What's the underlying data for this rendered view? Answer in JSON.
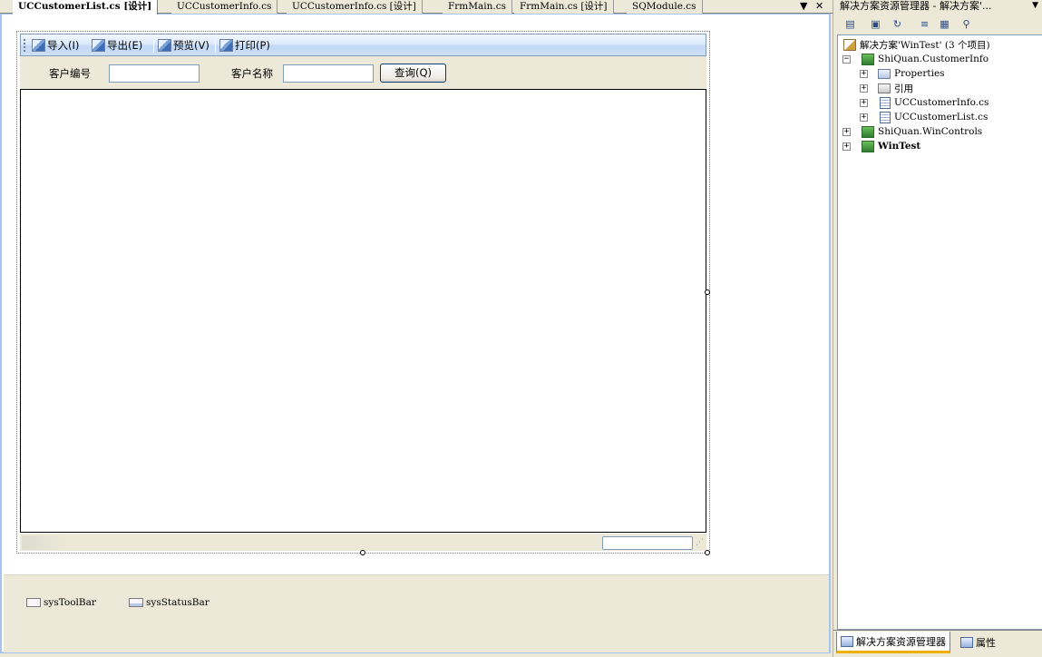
{
  "document_tabs": [
    {
      "label": "UCCustomerList.cs [设计]",
      "active": true
    },
    {
      "label": "UCCustomerInfo.cs",
      "active": false
    },
    {
      "label": "UCCustomerInfo.cs [设计]",
      "active": false
    },
    {
      "label": "FrmMain.cs",
      "active": false
    },
    {
      "label": "FrmMain.cs [设计]",
      "active": false
    },
    {
      "label": "SQModule.cs",
      "active": false
    }
  ],
  "tab_controls": {
    "dropdown": "▼",
    "close": "✕"
  },
  "toolbar": {
    "buttons": [
      {
        "label": "导入(I)",
        "icon": "image-icon"
      },
      {
        "label": "导出(E)",
        "icon": "image-icon"
      },
      {
        "label": "预览(V)",
        "icon": "image-icon"
      },
      {
        "label": "打印(P)",
        "icon": "image-icon"
      }
    ]
  },
  "query": {
    "customer_id_label": "客户编号",
    "customer_id_value": "",
    "customer_name_label": "客户名称",
    "customer_name_value": "",
    "search_button": "查询(Q)"
  },
  "component_tray": [
    {
      "label": "sysToolBar",
      "icon": "toolbar-component-icon"
    },
    {
      "label": "sysStatusBar",
      "icon": "statusbar-component-icon"
    }
  ],
  "solution_explorer": {
    "title": "解决方案资源管理器 - 解决方案'...",
    "pin": "▼",
    "toolbar_icons": [
      "properties-icon",
      "show-all-files-icon",
      "refresh-icon",
      "view-code-icon",
      "view-designer-icon",
      "class-diagram-icon"
    ],
    "tree": [
      {
        "label": "解决方案'WinTest' (3 个项目)",
        "level": 0,
        "icon": "solution-icon",
        "expander": "",
        "bold": false
      },
      {
        "label": "ShiQuan.CustomerInfo",
        "level": 1,
        "icon": "project-icon",
        "expander": "−",
        "bold": false
      },
      {
        "label": "Properties",
        "level": 2,
        "icon": "folder-icon",
        "expander": "+",
        "bold": false
      },
      {
        "label": "引用",
        "level": 2,
        "icon": "references-icon",
        "expander": "+",
        "bold": false
      },
      {
        "label": "UCCustomerInfo.cs",
        "level": 2,
        "icon": "usercontrol-file-icon",
        "expander": "+",
        "bold": false
      },
      {
        "label": "UCCustomerList.cs",
        "level": 2,
        "icon": "usercontrol-file-icon",
        "expander": "+",
        "bold": false
      },
      {
        "label": "ShiQuan.WinControls",
        "level": 1,
        "icon": "project-icon",
        "expander": "+",
        "bold": false
      },
      {
        "label": "WinTest",
        "level": 1,
        "icon": "project-icon",
        "expander": "+",
        "bold": true
      }
    ],
    "bottom_tabs": [
      {
        "label": "解决方案资源管理器",
        "active": true,
        "icon": "solution-explorer-icon"
      },
      {
        "label": "属性",
        "active": false,
        "icon": "properties-window-icon"
      }
    ]
  }
}
